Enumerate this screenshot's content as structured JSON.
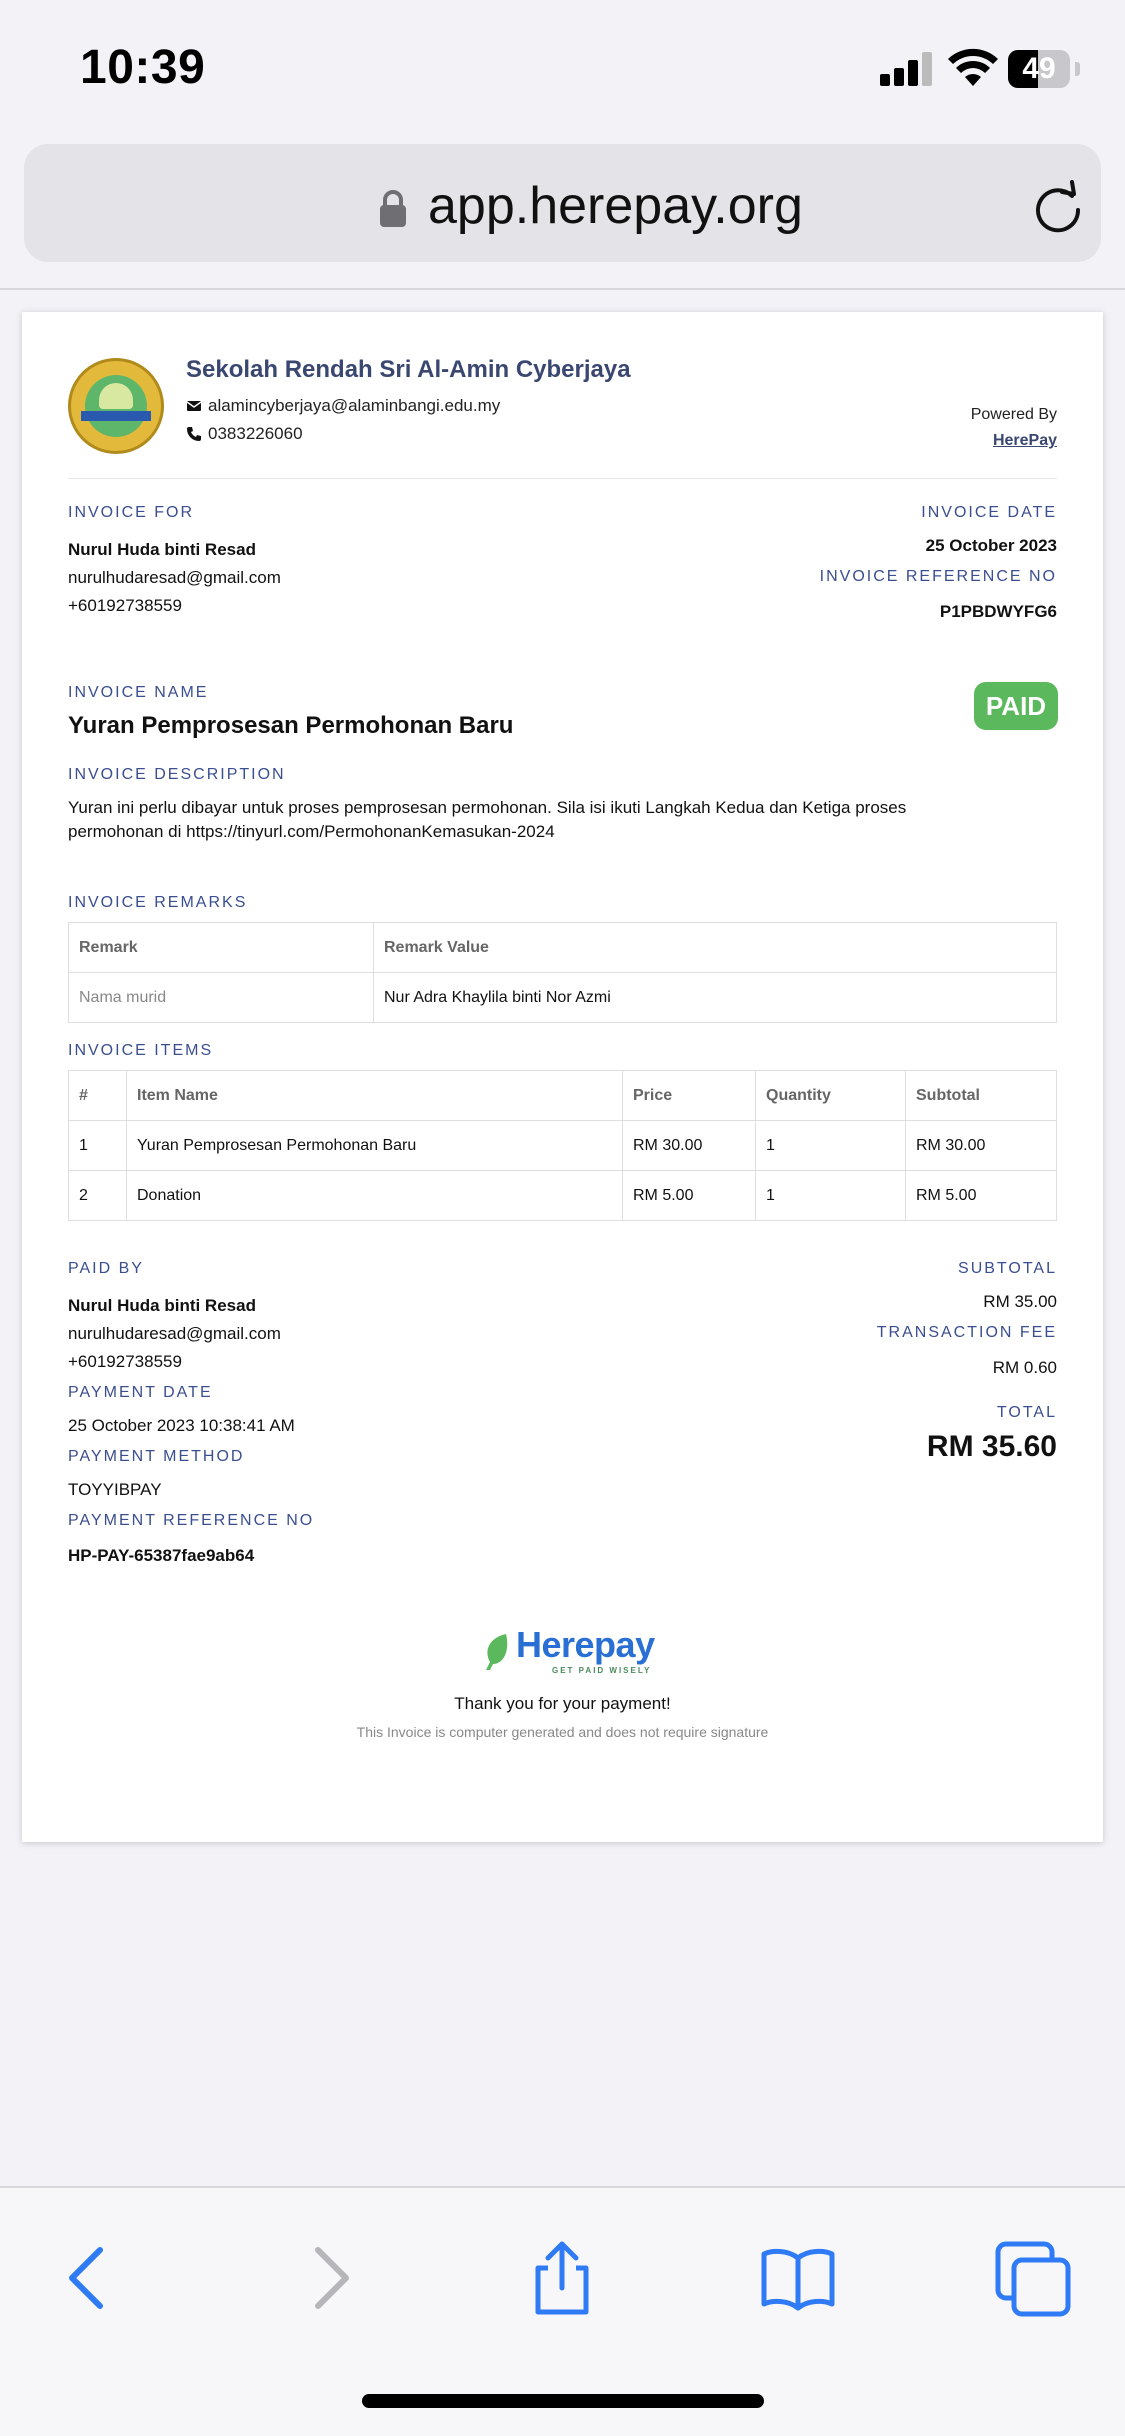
{
  "status_bar": {
    "time": "10:39",
    "battery": "49",
    "battery_level": 0.49
  },
  "browser": {
    "url": "app.herepay.org"
  },
  "school": {
    "name": "Sekolah Rendah Sri Al-Amin Cyberjaya",
    "email": "alamincyberjaya@alaminbangi.edu.my",
    "phone": "0383226060",
    "powered_by": "Powered By",
    "powered_by_link": "HerePay"
  },
  "invoice_for": {
    "label": "INVOICE FOR",
    "name": "Nurul Huda binti Resad",
    "email": "nurulhudaresad@gmail.com",
    "phone": "+60192738559"
  },
  "invoice_meta": {
    "date_label": "INVOICE DATE",
    "date": "25 October 2023",
    "ref_label": "INVOICE REFERENCE NO",
    "ref": "P1PBDWYFG6"
  },
  "invoice": {
    "name_label": "INVOICE NAME",
    "name": "Yuran Pemprosesan Permohonan Baru",
    "status": "PAID",
    "description_label": "INVOICE DESCRIPTION",
    "description": "Yuran ini perlu dibayar untuk proses pemprosesan permohonan. Sila isi ikuti Langkah Kedua dan Ketiga proses permohonan di https://tinyurl.com/PermohonanKemasukan-2024"
  },
  "remarks": {
    "label": "INVOICE REMARKS",
    "headers": [
      "Remark",
      "Remark Value"
    ],
    "rows": [
      [
        "Nama murid",
        "Nur Adra Khaylila binti Nor Azmi"
      ]
    ]
  },
  "items": {
    "label": "INVOICE ITEMS",
    "headers": [
      "#",
      "Item Name",
      "Price",
      "Quantity",
      "Subtotal"
    ],
    "rows": [
      [
        "1",
        "Yuran Pemprosesan Permohonan Baru",
        "RM 30.00",
        "1",
        "RM 30.00"
      ],
      [
        "2",
        "Donation",
        "RM 5.00",
        "1",
        "RM 5.00"
      ]
    ]
  },
  "paid_by": {
    "label": "PAID BY",
    "name": "Nurul Huda binti Resad",
    "email": "nurulhudaresad@gmail.com",
    "phone": "+60192738559",
    "date_label": "PAYMENT DATE",
    "date": "25 October 2023 10:38:41 AM",
    "method_label": "PAYMENT METHOD",
    "method": "TOYYIBPAY",
    "ref_label": "PAYMENT REFERENCE NO",
    "ref": "HP-PAY-65387fae9ab64"
  },
  "totals": {
    "subtotal_label": "SUBTOTAL",
    "subtotal": "RM 35.00",
    "fee_label": "TRANSACTION FEE",
    "fee": "RM 0.60",
    "total_label": "TOTAL",
    "total": "RM 35.60"
  },
  "footer": {
    "logo_text": "Herepay",
    "tagline": "GET PAID WISELY",
    "thanks": "Thank you for your payment!",
    "notice": "This Invoice is computer generated and does not require signature"
  },
  "colors": {
    "accent": "#3a4e90",
    "paid": "#5cb85c",
    "ios_blue": "#2f7bf6"
  }
}
